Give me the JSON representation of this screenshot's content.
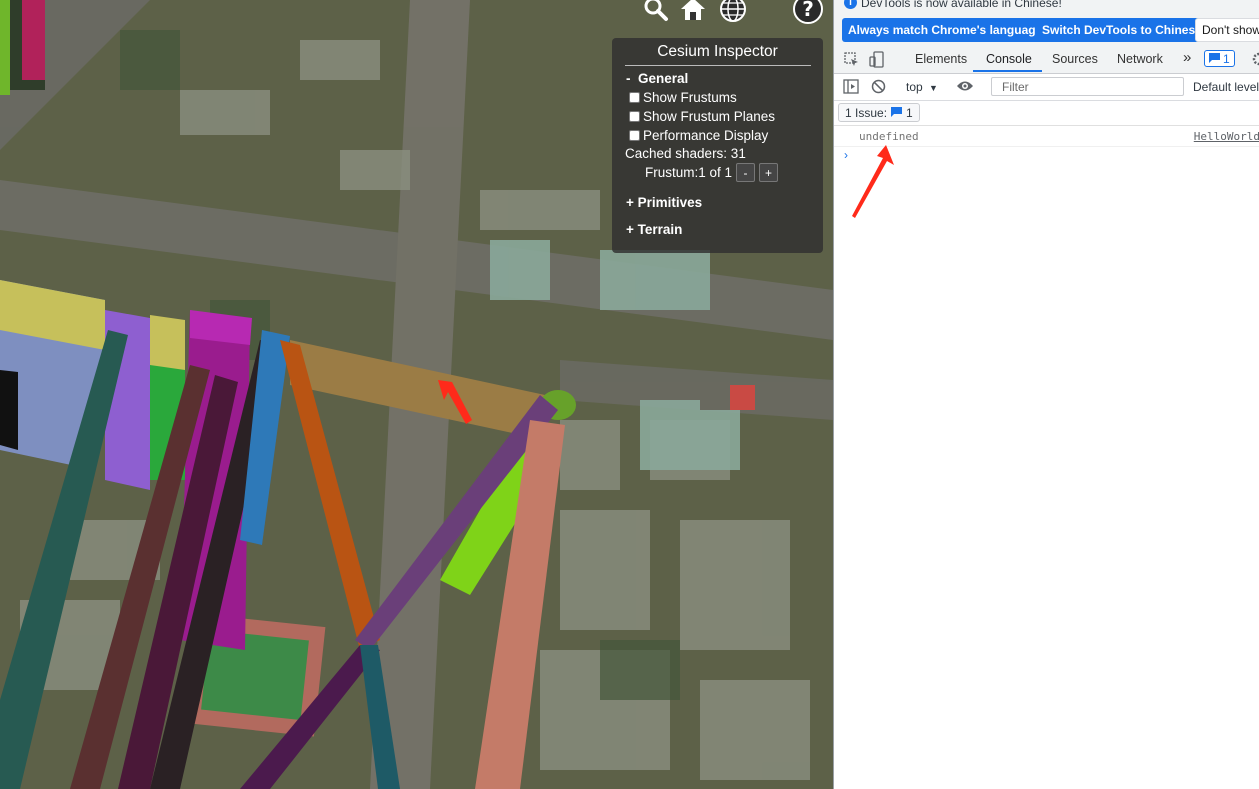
{
  "map_toolbar": {
    "buttons": [
      {
        "icon": "search-icon"
      },
      {
        "icon": "home-icon"
      },
      {
        "icon": "globe-icon"
      },
      {
        "icon": "help-icon",
        "label": "?"
      }
    ]
  },
  "inspector": {
    "title": "Cesium Inspector",
    "general": {
      "toggle": "-",
      "label": "General"
    },
    "options": [
      "Show Frustums",
      "Show Frustum Planes",
      "Performance Display"
    ],
    "cached_shaders": "Cached shaders: 31",
    "frustum": "Frustum:1 of 1",
    "minus": "-",
    "plus": "+",
    "primitives": {
      "toggle": "+",
      "label": "Primitives"
    },
    "terrain": {
      "toggle": "+",
      "label": "Terrain"
    }
  },
  "devtools": {
    "notice": {
      "text": "DevTools is now available in Chinese!",
      "btn_match": "Always match Chrome's language",
      "btn_switch": "Switch DevTools to Chinese",
      "btn_dont": "Don't show"
    },
    "tabs": [
      "Elements",
      "Console",
      "Sources",
      "Network"
    ],
    "active_tab": "Console",
    "more_tabs": "»",
    "message_count": "1",
    "context": "top",
    "context_caret": "▼",
    "filter_placeholder": "Filter",
    "default_levels": "Default levels",
    "issues_label": "1 Issue:",
    "issues_count": "1",
    "log_value": "undefined",
    "log_source": "HelloWorld",
    "prompt_glyph": "›"
  },
  "colors": {
    "accent": "#1a73e8",
    "arrow": "#ff2a1a",
    "inspector_bg": "#303030"
  }
}
